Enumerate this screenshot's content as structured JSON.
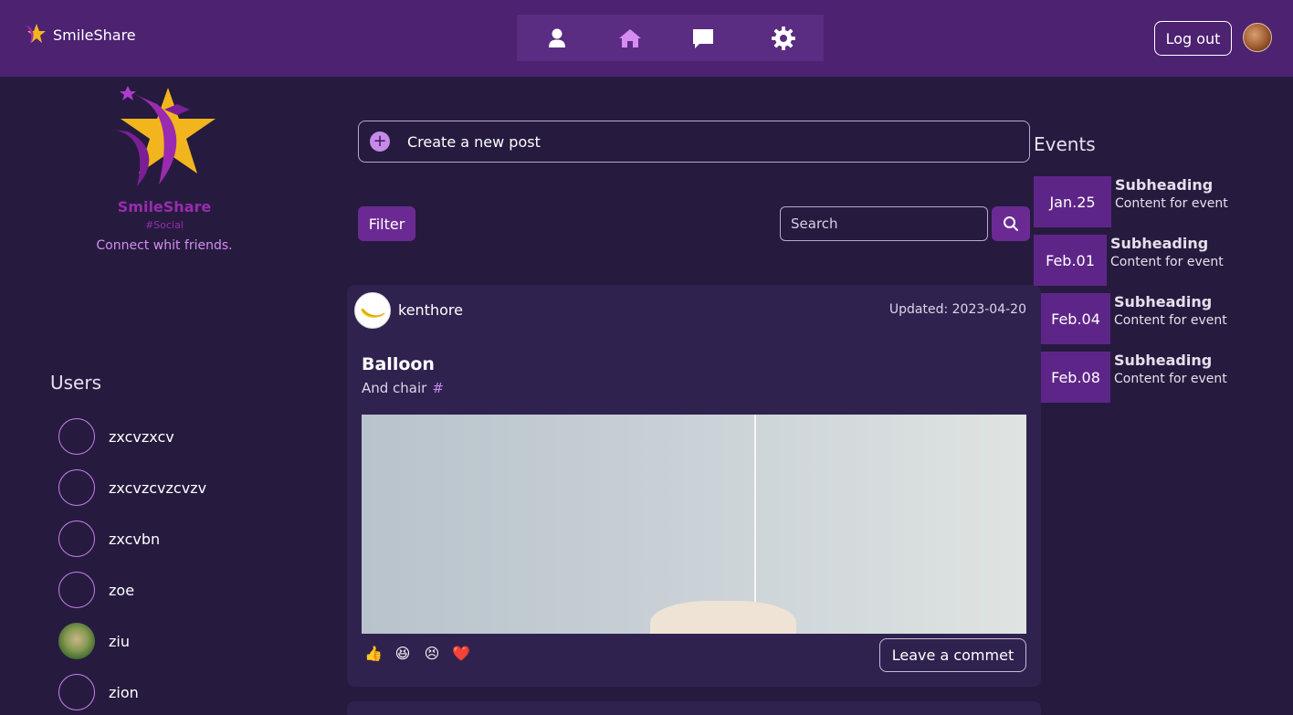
{
  "header": {
    "brand_name": "SmileShare",
    "nav": [
      {
        "name": "profile",
        "icon": "user-icon"
      },
      {
        "name": "home",
        "icon": "home-icon"
      },
      {
        "name": "messages",
        "icon": "chat-icon"
      },
      {
        "name": "settings",
        "icon": "gear-icon"
      }
    ],
    "logout_label": "Log out"
  },
  "sidebar": {
    "logo_title": "SmileShare",
    "logo_sub": "#Social",
    "tagline": "Connect whit friends.",
    "users_title": "Users",
    "users": [
      {
        "name": "zxcvzxcv",
        "has_photo": false
      },
      {
        "name": "zxcvzcvzcvzv",
        "has_photo": false
      },
      {
        "name": "zxcvbn",
        "has_photo": false
      },
      {
        "name": "zoe",
        "has_photo": false
      },
      {
        "name": "ziu",
        "has_photo": true
      },
      {
        "name": "zion",
        "has_photo": false
      }
    ]
  },
  "main": {
    "new_post_label": "Create a new post",
    "filter_label": "Filter",
    "search_placeholder": "Search",
    "post": {
      "author": "kenthore",
      "updated": "Updated: 2023-04-20",
      "title": "Balloon",
      "subtitle": "And chair",
      "hashtag": "#",
      "reactions": [
        "👍",
        "😆",
        "😣",
        "❤️"
      ],
      "comment_label": "Leave a commet"
    }
  },
  "events": {
    "title": "Events",
    "items": [
      {
        "date": "Jan.25",
        "heading": "Subheading",
        "content": "Content for event"
      },
      {
        "date": "Feb.01",
        "heading": "Subheading",
        "content": "Content for event"
      },
      {
        "date": "Feb.04",
        "heading": "Subheading",
        "content": "Content for event"
      },
      {
        "date": "Feb.08",
        "heading": "Subheading",
        "content": "Content for event"
      }
    ]
  },
  "colors": {
    "header_bg": "#4c2271",
    "page_bg": "#261b3e",
    "card_bg": "#30224f",
    "accent": "#6b2a93",
    "event_date_bg": "#5e2588",
    "tagline": "#d68cf2"
  }
}
